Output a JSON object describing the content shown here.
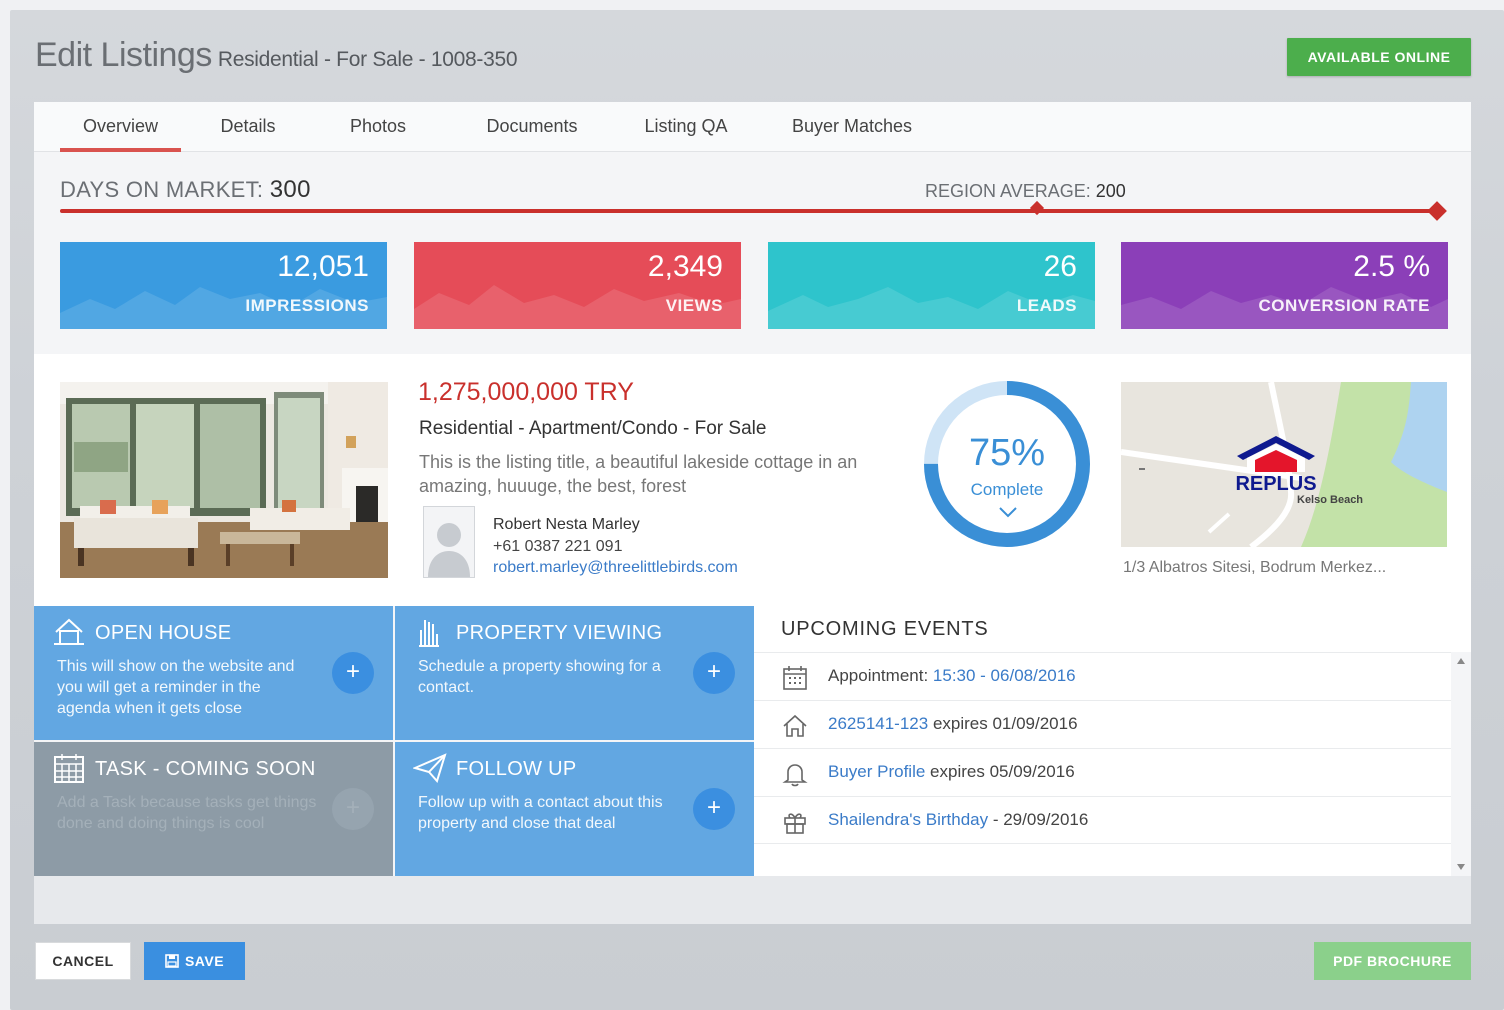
{
  "header": {
    "title": "Edit Listings",
    "subtitle": "Residential - For Sale - 1008-350",
    "available_label": "AVAILABLE ONLINE"
  },
  "tabs": [
    {
      "label": "Overview",
      "active": true
    },
    {
      "label": "Details"
    },
    {
      "label": "Photos"
    },
    {
      "label": "Documents"
    },
    {
      "label": "Listing QA"
    },
    {
      "label": "Buyer Matches"
    }
  ],
  "market": {
    "days_label": "DAYS ON MARKET:",
    "days_value": "300",
    "region_label": "REGION AVERAGE:",
    "region_value": "200"
  },
  "stats": [
    {
      "value": "12,051",
      "label": "IMPRESSIONS",
      "color": "#3a9be0"
    },
    {
      "value": "2,349",
      "label": "VIEWS",
      "color": "#e54c58"
    },
    {
      "value": "26",
      "label": "LEADS",
      "color": "#2ec4cc"
    },
    {
      "value": "2.5 %",
      "label": "CONVERSION RATE",
      "color": "#8b3fb8"
    }
  ],
  "listing": {
    "price": "1,275,000,000 TRY",
    "type_line": "Residential - Apartment/Condo - For Sale",
    "description": "This is the listing title, a beautiful lakeside cottage in an amazing, huuuge, the best, forest",
    "agent_name": "Robert Nesta Marley",
    "agent_phone": "+61 0387 221 091",
    "agent_email": "robert.marley@threelittlebirds.com",
    "complete_pct": "75%",
    "complete_label": "Complete",
    "complete_value": 0.75,
    "map_logo": "REPLUS",
    "map_label": "Kelso Beach",
    "address": "1/3 Albatros Sitesi, Bodrum Merkez..."
  },
  "tiles": {
    "open_house": {
      "title": "OPEN HOUSE",
      "text": "This will show on the website and you will get a reminder in the agenda when it gets close"
    },
    "property_viewing": {
      "title": "PROPERTY VIEWING",
      "text": "Schedule a property showing for a contact."
    },
    "task": {
      "title": "TASK - COMING SOON",
      "text": "Add a Task because tasks get things done and doing things is cool"
    },
    "follow_up": {
      "title": "FOLLOW UP",
      "text": "Follow up with a contact about this property and close that deal"
    },
    "plus": "+"
  },
  "events": {
    "title": "UPCOMING EVENTS",
    "items": [
      {
        "prefix": "Appointment: ",
        "link": "15:30 - 06/08/2016",
        "suffix": "",
        "icon": "calendar-icon"
      },
      {
        "prefix": "",
        "link": "2625141-123",
        "suffix": " expires 01/09/2016",
        "icon": "home-icon"
      },
      {
        "prefix": "",
        "link": "Buyer Profile",
        "suffix": " expires 05/09/2016",
        "icon": "bell-icon"
      },
      {
        "prefix": "",
        "link": "Shailendra's Birthday",
        "suffix": " - 29/09/2016",
        "icon": "gift-icon"
      }
    ]
  },
  "footer": {
    "cancel_label": "CANCEL",
    "save_label": "SAVE",
    "pdf_label": "PDF BROCHURE"
  }
}
